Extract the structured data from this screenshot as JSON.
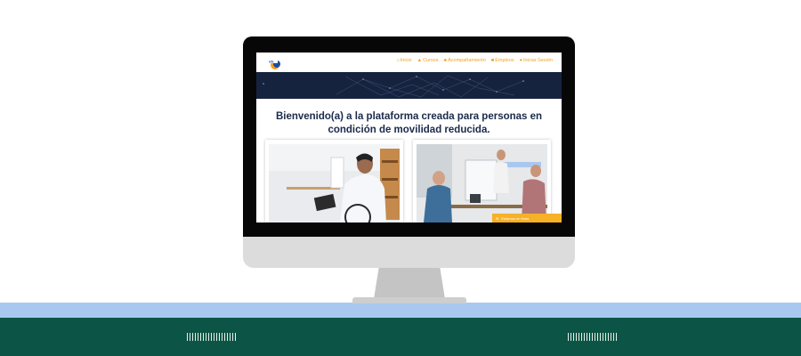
{
  "site": {
    "logo_label": "logo",
    "nav": [
      {
        "label": "Inicio",
        "icon": "home-icon"
      },
      {
        "label": "Cursos",
        "icon": "courses-icon"
      },
      {
        "label": "Acompañamiento",
        "icon": "support-icon"
      },
      {
        "label": "Empleos",
        "icon": "briefcase-icon"
      },
      {
        "label": "Iniciar Sesión",
        "icon": "user-icon"
      }
    ],
    "headline_line1": "Bienvenido(a) a la plataforma creada para personas en",
    "headline_line2": "condición de movilidad reducida.",
    "toast": "Estamos en línea"
  },
  "colors": {
    "accent": "#f3a21a",
    "banner": "#16233f",
    "desk_top": "#a9c8ef",
    "desk_bottom": "#0b5446"
  }
}
